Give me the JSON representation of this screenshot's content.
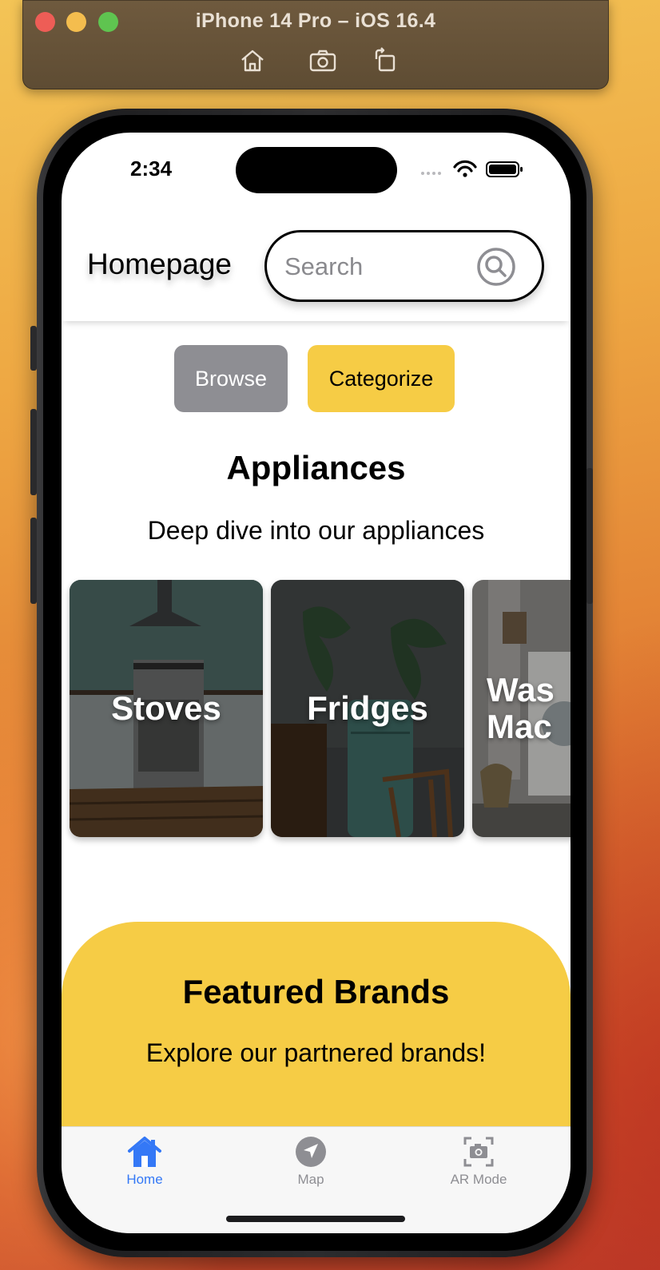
{
  "simulator": {
    "title": "iPhone 14 Pro – iOS 16.4",
    "buttons": [
      "home-icon",
      "screenshot-icon",
      "rotate-icon"
    ]
  },
  "status_bar": {
    "time": "2:34"
  },
  "header": {
    "title": "Homepage",
    "search_placeholder": "Search"
  },
  "segment": {
    "browse_label": "Browse",
    "categorize_label": "Categorize"
  },
  "appliances": {
    "title": "Appliances",
    "subtitle": "Deep dive into our appliances",
    "cards": [
      {
        "label": "Stoves"
      },
      {
        "label": "Fridges"
      },
      {
        "label": "Was\nMac"
      }
    ]
  },
  "featured": {
    "title": "Featured Brands",
    "subtitle": "Explore our partnered brands!"
  },
  "tabbar": {
    "tabs": [
      {
        "label": "Home",
        "icon": "house-icon",
        "active": true
      },
      {
        "label": "Map",
        "icon": "location-arrow-icon",
        "active": false
      },
      {
        "label": "AR Mode",
        "icon": "camera-viewfinder-icon",
        "active": false
      }
    ]
  },
  "colors": {
    "accent_yellow": "#f6cc45",
    "browse_gray": "#8e8e93",
    "tab_active": "#3478f6",
    "tab_inactive": "#8e8e93"
  }
}
